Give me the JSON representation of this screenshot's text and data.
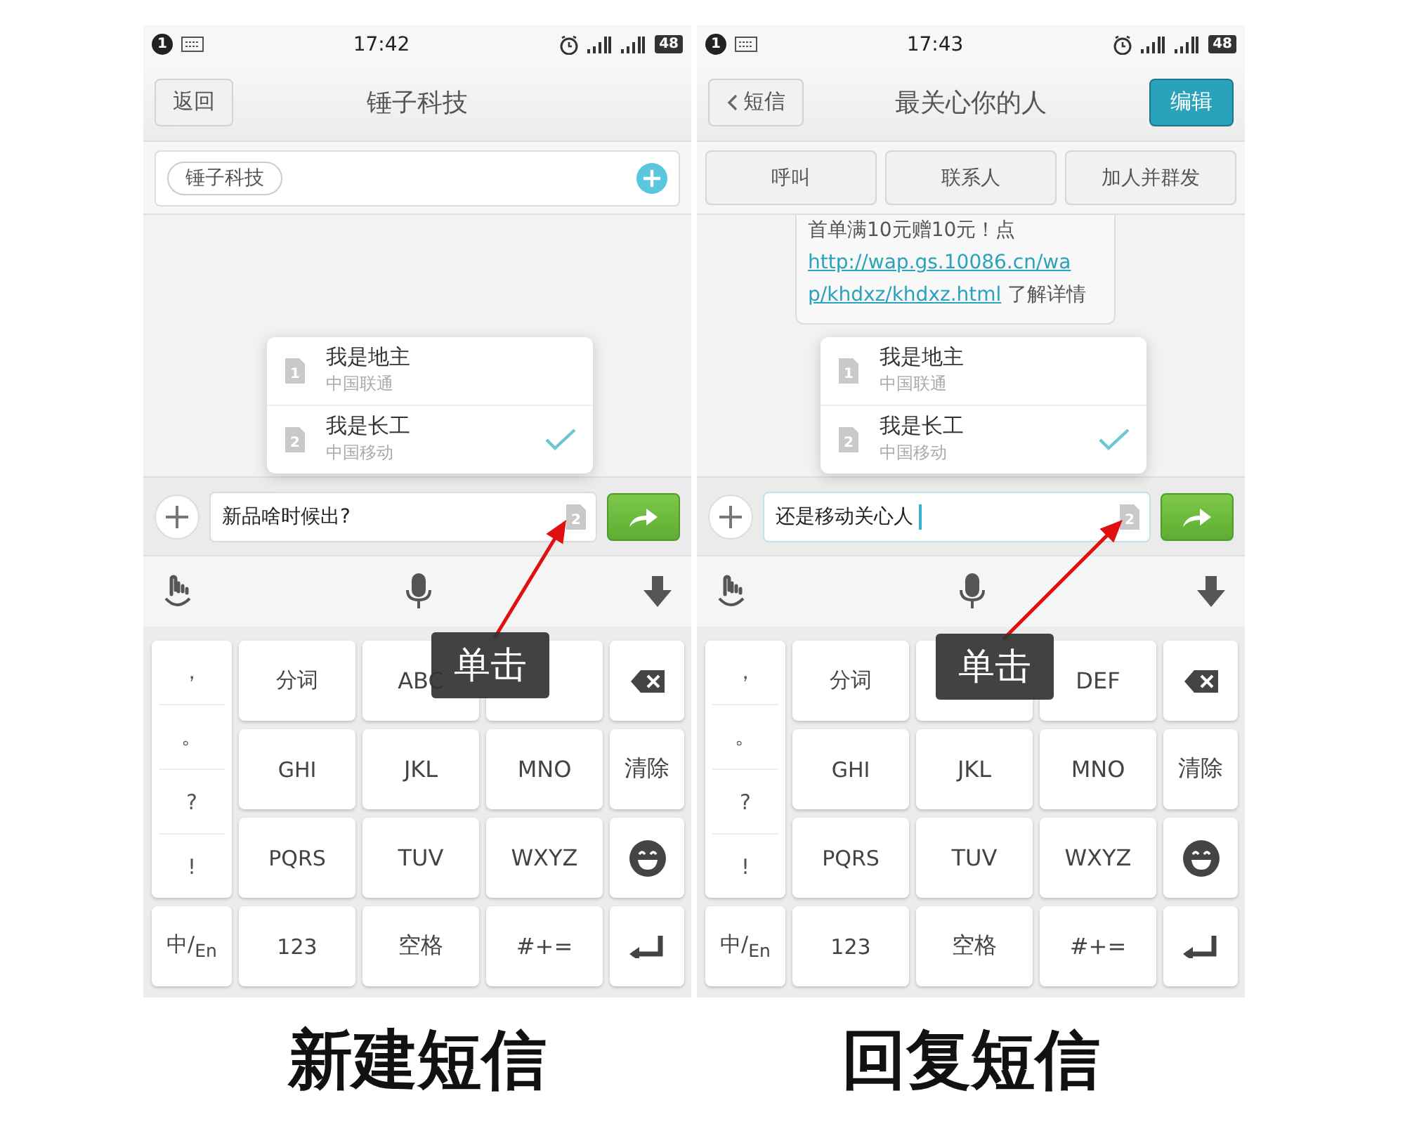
{
  "panels": [
    {
      "kind": "new",
      "status_bar": {
        "badge": "1",
        "time": "17:42",
        "battery": "48"
      },
      "nav": {
        "back": "返回",
        "title": "锤子科技"
      },
      "recipients": {
        "chips": [
          "锤子科技"
        ]
      },
      "sim_menu": [
        {
          "sim": "1",
          "name": "我是地主",
          "carrier": "中国联通",
          "selected": false
        },
        {
          "sim": "2",
          "name": "我是长工",
          "carrier": "中国移动",
          "selected": true
        }
      ],
      "compose": {
        "value": "新品啥时候出?",
        "focused": false,
        "sim": "2"
      },
      "punctuation": [
        "，",
        "。",
        "?",
        "!"
      ],
      "lang_key": "中/$_{En}$",
      "keys": [
        {
          "kind": "text",
          "label": "分词"
        },
        {
          "kind": "text",
          "label": "ABC"
        },
        {
          "kind": "text"
        },
        {
          "kind": "backspace"
        },
        {
          "kind": "text",
          "label": "GHI"
        },
        {
          "kind": "text",
          "label": "JKL"
        },
        {
          "kind": "text",
          "label": "MNO"
        },
        {
          "kind": "text",
          "label": "清除"
        },
        {
          "kind": "text",
          "label": "PQRS"
        },
        {
          "kind": "text",
          "label": "TUV"
        },
        {
          "kind": "text",
          "label": "WXYZ"
        },
        {
          "kind": "emoji"
        },
        {
          "kind": "text",
          "label": "123"
        },
        {
          "kind": "text",
          "label": "空格"
        },
        {
          "kind": "text",
          "label": "#+="
        },
        {
          "kind": "enter"
        }
      ],
      "annotation": {
        "label": "单击"
      },
      "caption": "新建短信"
    },
    {
      "kind": "reply",
      "status_bar": {
        "badge": "1",
        "time": "17:43",
        "battery": "48"
      },
      "nav": {
        "back": "短信",
        "title": "最关心你的人",
        "edit": "编辑"
      },
      "actions": [
        "呼叫",
        "联系人",
        "加人并群发"
      ],
      "message": {
        "text": "首单满10元赠10元！点",
        "link_lines": [
          "http://wap.gs.10086.cn/wa",
          "p/khdxz/khdxz.html"
        ],
        "tail": "了解详情"
      },
      "sim_menu": [
        {
          "sim": "1",
          "name": "我是地主",
          "carrier": "中国联通",
          "selected": false
        },
        {
          "sim": "2",
          "name": "我是长工",
          "carrier": "中国移动",
          "selected": true
        }
      ],
      "compose": {
        "value": "还是移动关心人",
        "focused": true,
        "sim": "2"
      },
      "punctuation": [
        "，",
        "。",
        "?",
        "!"
      ],
      "lang_key": "中/$_{En}$",
      "keys": [
        {
          "kind": "text",
          "label": "分词"
        },
        {
          "kind": "text"
        },
        {
          "kind": "text",
          "label": "DEF"
        },
        {
          "kind": "backspace"
        },
        {
          "kind": "text",
          "label": "GHI"
        },
        {
          "kind": "text",
          "label": "JKL"
        },
        {
          "kind": "text",
          "label": "MNO"
        },
        {
          "kind": "text",
          "label": "清除"
        },
        {
          "kind": "text",
          "label": "PQRS"
        },
        {
          "kind": "text",
          "label": "TUV"
        },
        {
          "kind": "text",
          "label": "WXYZ"
        },
        {
          "kind": "emoji"
        },
        {
          "kind": "text",
          "label": "123"
        },
        {
          "kind": "text",
          "label": "空格"
        },
        {
          "kind": "text",
          "label": "#+="
        },
        {
          "kind": "enter"
        }
      ],
      "annotation": {
        "label": "单击"
      },
      "caption": "回复短信"
    }
  ]
}
